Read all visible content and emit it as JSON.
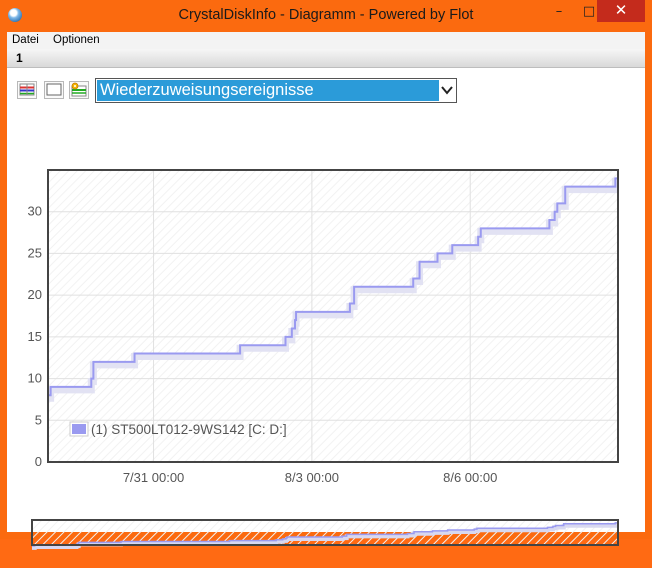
{
  "window": {
    "title": "CrystalDiskInfo - Diagramm - Powered by Flot",
    "minimize_glyph": "–",
    "maximize_glyph": "□",
    "close_glyph": "✕"
  },
  "menu": {
    "items": [
      "Datei",
      "Optionen"
    ]
  },
  "tabs": [
    {
      "label": "1"
    }
  ],
  "toolbar": {
    "icons": [
      "select-all-icon",
      "select-none-icon",
      "settings-icon"
    ],
    "attribute_select": {
      "selected": "Wiederzuweisungsereignisse"
    }
  },
  "colors": {
    "titlebar": "#fb6a0f",
    "close_button": "#c42b1c",
    "select_highlight": "#2b9bd9",
    "series": "#9a9af0",
    "grid": "#e0e0e0"
  },
  "chart_data": {
    "type": "line",
    "step": true,
    "x_ticks": [
      "7/31 00:00",
      "8/3 00:00",
      "8/6 00:00"
    ],
    "x_tick_days": [
      2,
      5,
      8
    ],
    "xlim_days": [
      0,
      10.8
    ],
    "ylim": [
      0,
      35
    ],
    "y_ticks": [
      0,
      5,
      10,
      15,
      20,
      25,
      30
    ],
    "grid": true,
    "legend": {
      "position": "bottom-left"
    },
    "series": [
      {
        "name": "(1) ST500LT012-9WS142 [C: D:]",
        "x_days": [
          0.0,
          0.05,
          0.8,
          0.82,
          0.86,
          1.6,
          1.64,
          3.6,
          3.64,
          4.45,
          4.5,
          4.58,
          4.62,
          4.68,
          4.7,
          5.7,
          5.72,
          5.8,
          5.83,
          6.88,
          6.92,
          7.0,
          7.04,
          7.35,
          7.38,
          7.64,
          7.66,
          8.15,
          8.2,
          9.45,
          9.5,
          9.6,
          9.65,
          9.75,
          9.8,
          10.72,
          10.75,
          10.8
        ],
        "y": [
          8,
          9,
          9,
          10,
          12,
          12,
          13,
          13,
          14,
          14,
          15,
          15,
          16,
          17,
          18,
          18,
          19,
          21,
          21,
          21,
          22,
          22,
          24,
          24,
          25,
          25,
          26,
          27,
          28,
          28,
          29,
          30,
          31,
          31,
          33,
          33,
          34,
          34
        ]
      }
    ]
  }
}
